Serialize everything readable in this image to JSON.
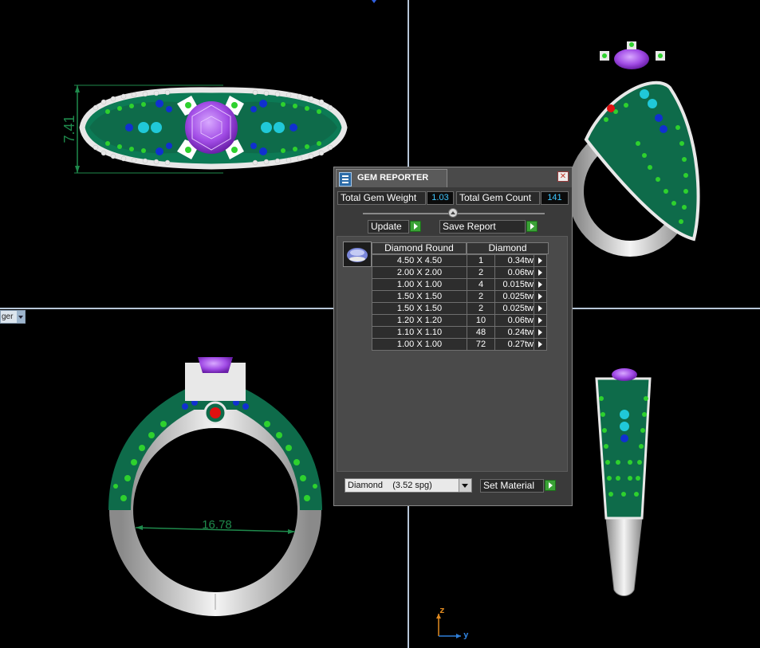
{
  "viewports": {
    "top_view_dimension": "7.41",
    "front_view_dimension": "16.78",
    "combo_stub_text": "ger",
    "axes": {
      "vertical": "z",
      "horizontal": "y"
    }
  },
  "gem_reporter": {
    "title": "GEM REPORTER",
    "close_symbol": "✕",
    "total_weight_label": "Total Gem Weight",
    "total_weight_value": "1.03",
    "total_count_label": "Total Gem Count",
    "total_count_value": "141",
    "update_label": "Update",
    "save_report_label": "Save Report",
    "headers": {
      "shape": "Diamond Round",
      "material": "Diamond"
    },
    "rows": [
      {
        "size": "4.50 X 4.50",
        "count": "1",
        "tw": "0.34tw"
      },
      {
        "size": "2.00 X 2.00",
        "count": "2",
        "tw": "0.06tw"
      },
      {
        "size": "1.00 X 1.00",
        "count": "4",
        "tw": "0.015tw"
      },
      {
        "size": "1.50 X 1.50",
        "count": "2",
        "tw": "0.025tw"
      },
      {
        "size": "1.50 X 1.50",
        "count": "2",
        "tw": "0.025tw"
      },
      {
        "size": "1.20 X 1.20",
        "count": "10",
        "tw": "0.06tw"
      },
      {
        "size": "1.10 X 1.10",
        "count": "48",
        "tw": "0.24tw"
      },
      {
        "size": "1.00 X 1.00",
        "count": "72",
        "tw": "0.27tw"
      }
    ],
    "material_select_value": "Diamond    (3.52 spg)",
    "set_material_label": "Set Material"
  },
  "colors": {
    "background": "#000000",
    "viewport_divider": "#b7c6d8",
    "panel_bg": "#3a3a3a",
    "value_cyan": "#3fc7ff",
    "go_green": "#3aa236",
    "center_stone_purple": "#a24de6",
    "accent_stone_red": "#e01010",
    "accent_stone_cyan": "#20c8d8",
    "accent_stone_blue": "#1030d0",
    "pave_green": "#2ed12e",
    "metal_white": "#e6e6e6",
    "dimension_green": "#1f8a4c"
  }
}
